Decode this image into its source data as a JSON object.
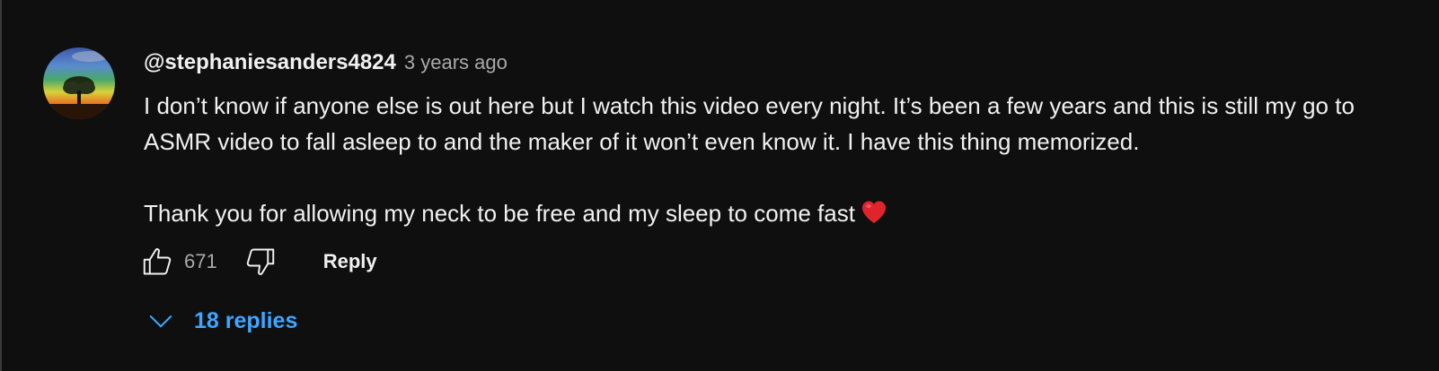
{
  "comment": {
    "author": "@stephaniesanders4824",
    "timestamp": "3 years ago",
    "paragraphs": [
      "I don’t know if anyone else is out here but I watch this video every night. It’s been a few years and this is still my go to ASMR video to fall asleep to and the maker of it won’t even know it. I have this thing memorized.",
      "Thank you for allowing my neck to be free and my sleep to come fast"
    ],
    "emoji": "red-heart",
    "like_count": "671",
    "reply_label": "Reply",
    "replies_label": "18 replies"
  },
  "icons": {
    "like": "thumbs-up-icon",
    "dislike": "thumbs-down-icon",
    "expand": "chevron-down-icon",
    "heart": "red-heart-icon"
  },
  "colors": {
    "background": "#0f0f0f",
    "text": "#f1f1f1",
    "secondary_text": "#aaaaaa",
    "link_blue": "#3ea6ff",
    "heart_red": "#e0242b"
  }
}
